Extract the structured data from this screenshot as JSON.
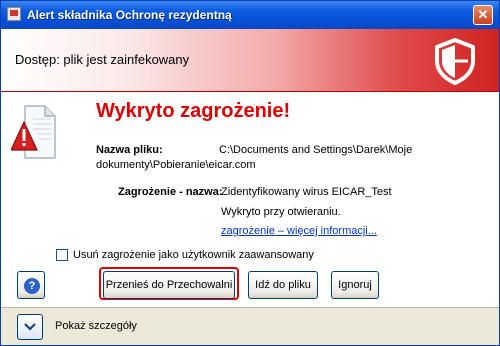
{
  "window": {
    "title": "Alert składnika Ochronę rezydentną",
    "close_glyph": "✕"
  },
  "banner": {
    "text": "Dostęp: plik jest zainfekowany",
    "icon": "shield-icon",
    "accent": "#cf2222"
  },
  "alert": {
    "icon": "document-warning-icon",
    "heading": "Wykryto zagrożenie!",
    "file_label": "Nazwa pliku:",
    "file_path_line1": "C:\\Documents and Settings\\Darek\\Moje",
    "file_path_line2": "dokumenty\\Pobieranie\\eicar.com",
    "threat_label": "Zagrożenie - nazwa:",
    "threat_value": "Zidentyfikowany wirus EICAR_Test",
    "detected_on": "Wykryto przy otwieraniu.",
    "more_info_link": "zagrożenie – więcej informacji..."
  },
  "checkbox": {
    "label": "Usuń zagrożenie jako użytkownik zaawansowany",
    "checked": false
  },
  "buttons": {
    "help": "?",
    "move_to_vault": "Przenieś do Przechowalni",
    "go_to_file": "Idź do pliku",
    "ignore": "Ignoruj"
  },
  "footer": {
    "show_details": "Pokaż szczegóły",
    "icon": "chevron-down-icon"
  }
}
